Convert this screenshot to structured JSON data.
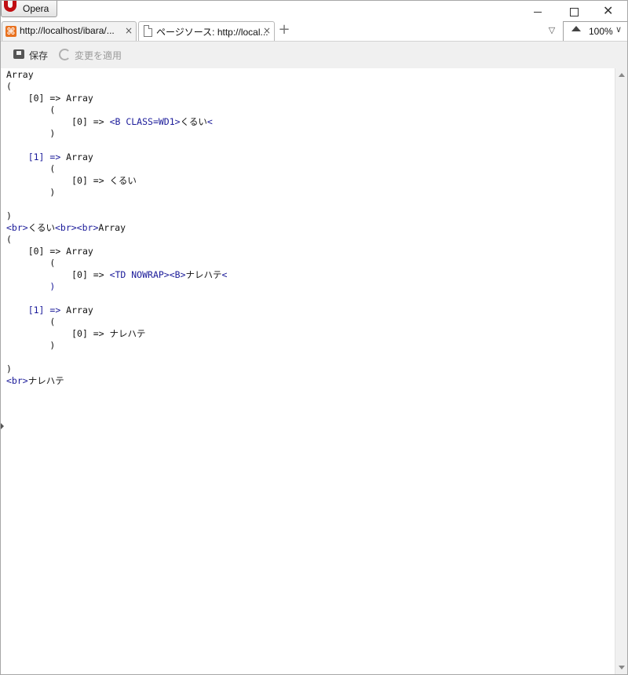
{
  "app": {
    "menu_label": "Opera"
  },
  "tabs": [
    {
      "title": "http://localhost/ibara/...",
      "close": "×"
    },
    {
      "title": "ページソース: http://local...",
      "close": "×"
    }
  ],
  "new_tab": "+",
  "tab_menu": "▽",
  "zoom": {
    "value": "100%",
    "dropdown": "∨"
  },
  "toolbar": {
    "save_label": "保存",
    "apply_label": "変更を適用"
  },
  "source_lines": [
    {
      "indent": "",
      "segments": [
        {
          "text": "Array"
        }
      ]
    },
    {
      "indent": "",
      "segments": [
        {
          "text": "("
        }
      ]
    },
    {
      "indent": "    ",
      "segments": [
        {
          "text": "[0] => Array"
        }
      ]
    },
    {
      "indent": "        ",
      "segments": [
        {
          "text": "("
        }
      ]
    },
    {
      "indent": "            ",
      "segments": [
        {
          "text": "[0] => "
        },
        {
          "text": "<B CLASS=WD1>",
          "tag": true
        },
        {
          "text": "くるい"
        },
        {
          "text": "<",
          "tag": true
        }
      ]
    },
    {
      "indent": "        ",
      "segments": [
        {
          "text": ")"
        }
      ]
    },
    {
      "indent": "",
      "segments": []
    },
    {
      "indent": "    ",
      "segments": [
        {
          "text": "[1] =>",
          "tag": true
        },
        {
          "text": " Array"
        }
      ]
    },
    {
      "indent": "        ",
      "segments": [
        {
          "text": "("
        }
      ]
    },
    {
      "indent": "            ",
      "segments": [
        {
          "text": "[0] => くるい"
        }
      ]
    },
    {
      "indent": "        ",
      "segments": [
        {
          "text": ")"
        }
      ]
    },
    {
      "indent": "",
      "segments": []
    },
    {
      "indent": "",
      "segments": [
        {
          "text": ")"
        }
      ]
    },
    {
      "indent": "",
      "segments": [
        {
          "text": "<br>",
          "tag": true
        },
        {
          "text": "くるい"
        },
        {
          "text": "<br><br>",
          "tag": true
        },
        {
          "text": "Array"
        }
      ]
    },
    {
      "indent": "",
      "segments": [
        {
          "text": "("
        }
      ]
    },
    {
      "indent": "    ",
      "segments": [
        {
          "text": "[0] => Array"
        }
      ]
    },
    {
      "indent": "        ",
      "segments": [
        {
          "text": "("
        }
      ]
    },
    {
      "indent": "            ",
      "segments": [
        {
          "text": "[0] => "
        },
        {
          "text": "<TD NOWRAP><B>",
          "tag": true
        },
        {
          "text": "ナレハテ"
        },
        {
          "text": "<",
          "tag": true
        }
      ]
    },
    {
      "indent": "        ",
      "segments": [
        {
          "text": ")",
          "tag": true
        }
      ]
    },
    {
      "indent": "",
      "segments": []
    },
    {
      "indent": "    ",
      "segments": [
        {
          "text": "[1] =>",
          "tag": true
        },
        {
          "text": " Array"
        }
      ]
    },
    {
      "indent": "        ",
      "segments": [
        {
          "text": "("
        }
      ]
    },
    {
      "indent": "            ",
      "segments": [
        {
          "text": "[0] => ナレハテ"
        }
      ]
    },
    {
      "indent": "        ",
      "segments": [
        {
          "text": ")"
        }
      ]
    },
    {
      "indent": "",
      "segments": []
    },
    {
      "indent": "",
      "segments": [
        {
          "text": ")"
        }
      ]
    },
    {
      "indent": "",
      "segments": [
        {
          "text": "<br>",
          "tag": true
        },
        {
          "text": "ナレハテ"
        }
      ]
    }
  ],
  "colors": {
    "tag": "#1a1a99",
    "text": "#111111",
    "opera_brand": "#c00e12",
    "favicon": "#e8711f"
  }
}
